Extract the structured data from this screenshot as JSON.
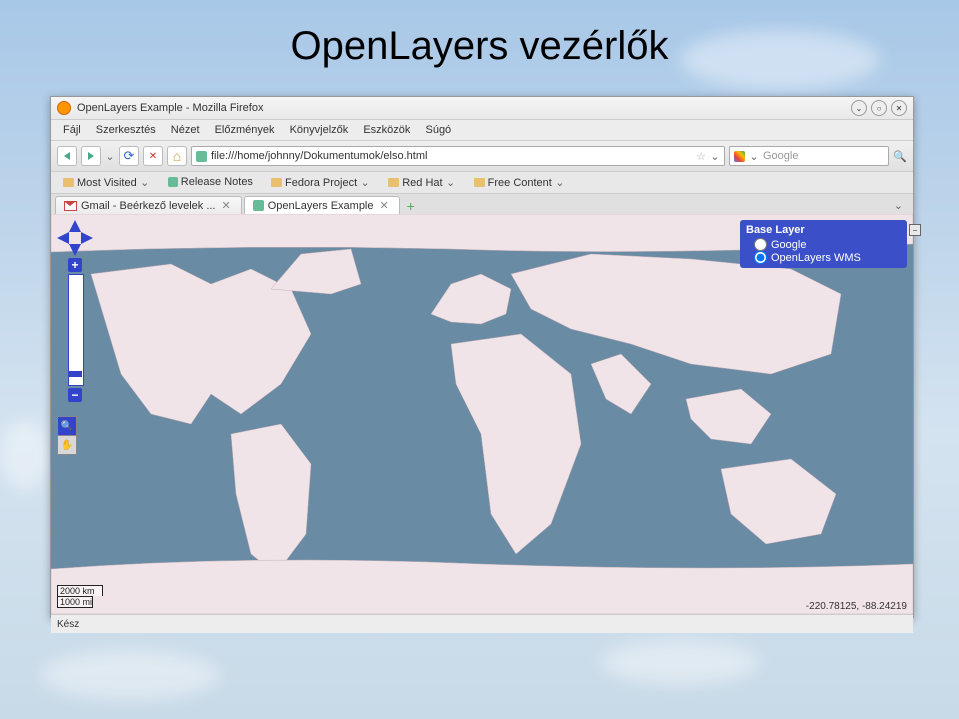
{
  "slide": {
    "title": "OpenLayers vezérlők"
  },
  "window": {
    "title": "OpenLayers Example - Mozilla Firefox"
  },
  "menu": {
    "file": "Fájl",
    "edit": "Szerkesztés",
    "view": "Nézet",
    "history": "Előzmények",
    "bookmarks": "Könyvjelzők",
    "tools": "Eszközök",
    "help": "Súgó"
  },
  "url": "file:///home/johnny/Dokumentumok/elso.html",
  "search": {
    "placeholder": "Google"
  },
  "bookmarks": {
    "items": [
      "Most Visited",
      "Release Notes",
      "Fedora Project",
      "Red Hat",
      "Free Content"
    ]
  },
  "tabs": {
    "items": [
      {
        "label": "Gmail - Beérkező levelek ..."
      },
      {
        "label": "OpenLayers Example"
      }
    ]
  },
  "layerSwitcher": {
    "title": "Base Layer",
    "options": [
      "Google",
      "OpenLayers WMS"
    ]
  },
  "scaleLine": {
    "top": "2000 km",
    "bottom": "1000 mi"
  },
  "mousePosition": "-220.78125, -88.24219",
  "status": "Kész",
  "icons": {
    "star": "☆",
    "dropdown": "⌄",
    "minimize": "⌄",
    "maximize": "○",
    "close": "✕",
    "plus": "+",
    "minus": "−",
    "collapse": "−",
    "newtab": "+"
  }
}
